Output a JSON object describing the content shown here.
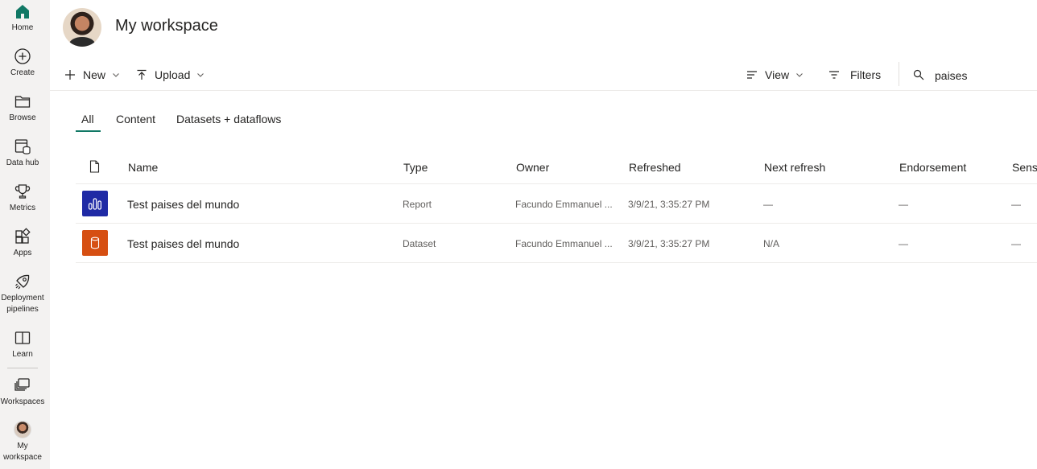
{
  "rail": {
    "items": [
      {
        "label": "Home",
        "icon": "home-icon"
      },
      {
        "label": "Create",
        "icon": "plus-circle-icon"
      },
      {
        "label": "Browse",
        "icon": "folder-icon"
      },
      {
        "label": "Data hub",
        "icon": "data-hub-icon"
      },
      {
        "label": "Metrics",
        "icon": "trophy-icon"
      },
      {
        "label": "Apps",
        "icon": "apps-icon"
      },
      {
        "label": "Deployment",
        "label2": "pipelines",
        "icon": "rocket-icon"
      },
      {
        "label": "Learn",
        "icon": "book-icon"
      },
      {
        "label": "Workspaces",
        "icon": "workspaces-icon"
      },
      {
        "label": "My",
        "label2": "workspace",
        "icon": "avatar"
      }
    ]
  },
  "header": {
    "title": "My workspace"
  },
  "toolbar": {
    "new_label": "New",
    "upload_label": "Upload",
    "view_label": "View",
    "filters_label": "Filters",
    "search_value": "paises"
  },
  "tabs": [
    {
      "label": "All",
      "active": true
    },
    {
      "label": "Content",
      "active": false
    },
    {
      "label": "Datasets + dataflows",
      "active": false
    }
  ],
  "table": {
    "columns": [
      "Name",
      "Type",
      "Owner",
      "Refreshed",
      "Next refresh",
      "Endorsement",
      "Sensi"
    ],
    "rows": [
      {
        "name": "Test paises del mundo",
        "type": "Report",
        "owner": "Facundo Emmanuel ...",
        "refreshed": "3/9/21, 3:35:27 PM",
        "next_refresh": "—",
        "endorsement": "—",
        "sensitivity": "—",
        "icon": "report-icon"
      },
      {
        "name": "Test paises del mundo",
        "type": "Dataset",
        "owner": "Facundo Emmanuel ...",
        "refreshed": "3/9/21, 3:35:27 PM",
        "next_refresh": "N/A",
        "endorsement": "—",
        "sensitivity": "—",
        "icon": "dataset-icon"
      }
    ]
  },
  "colors": {
    "rail_bg": "#f3f2f1",
    "accent": "#117865",
    "report_icon_bg": "#1f2aa5",
    "dataset_icon_bg": "#d64f12"
  }
}
